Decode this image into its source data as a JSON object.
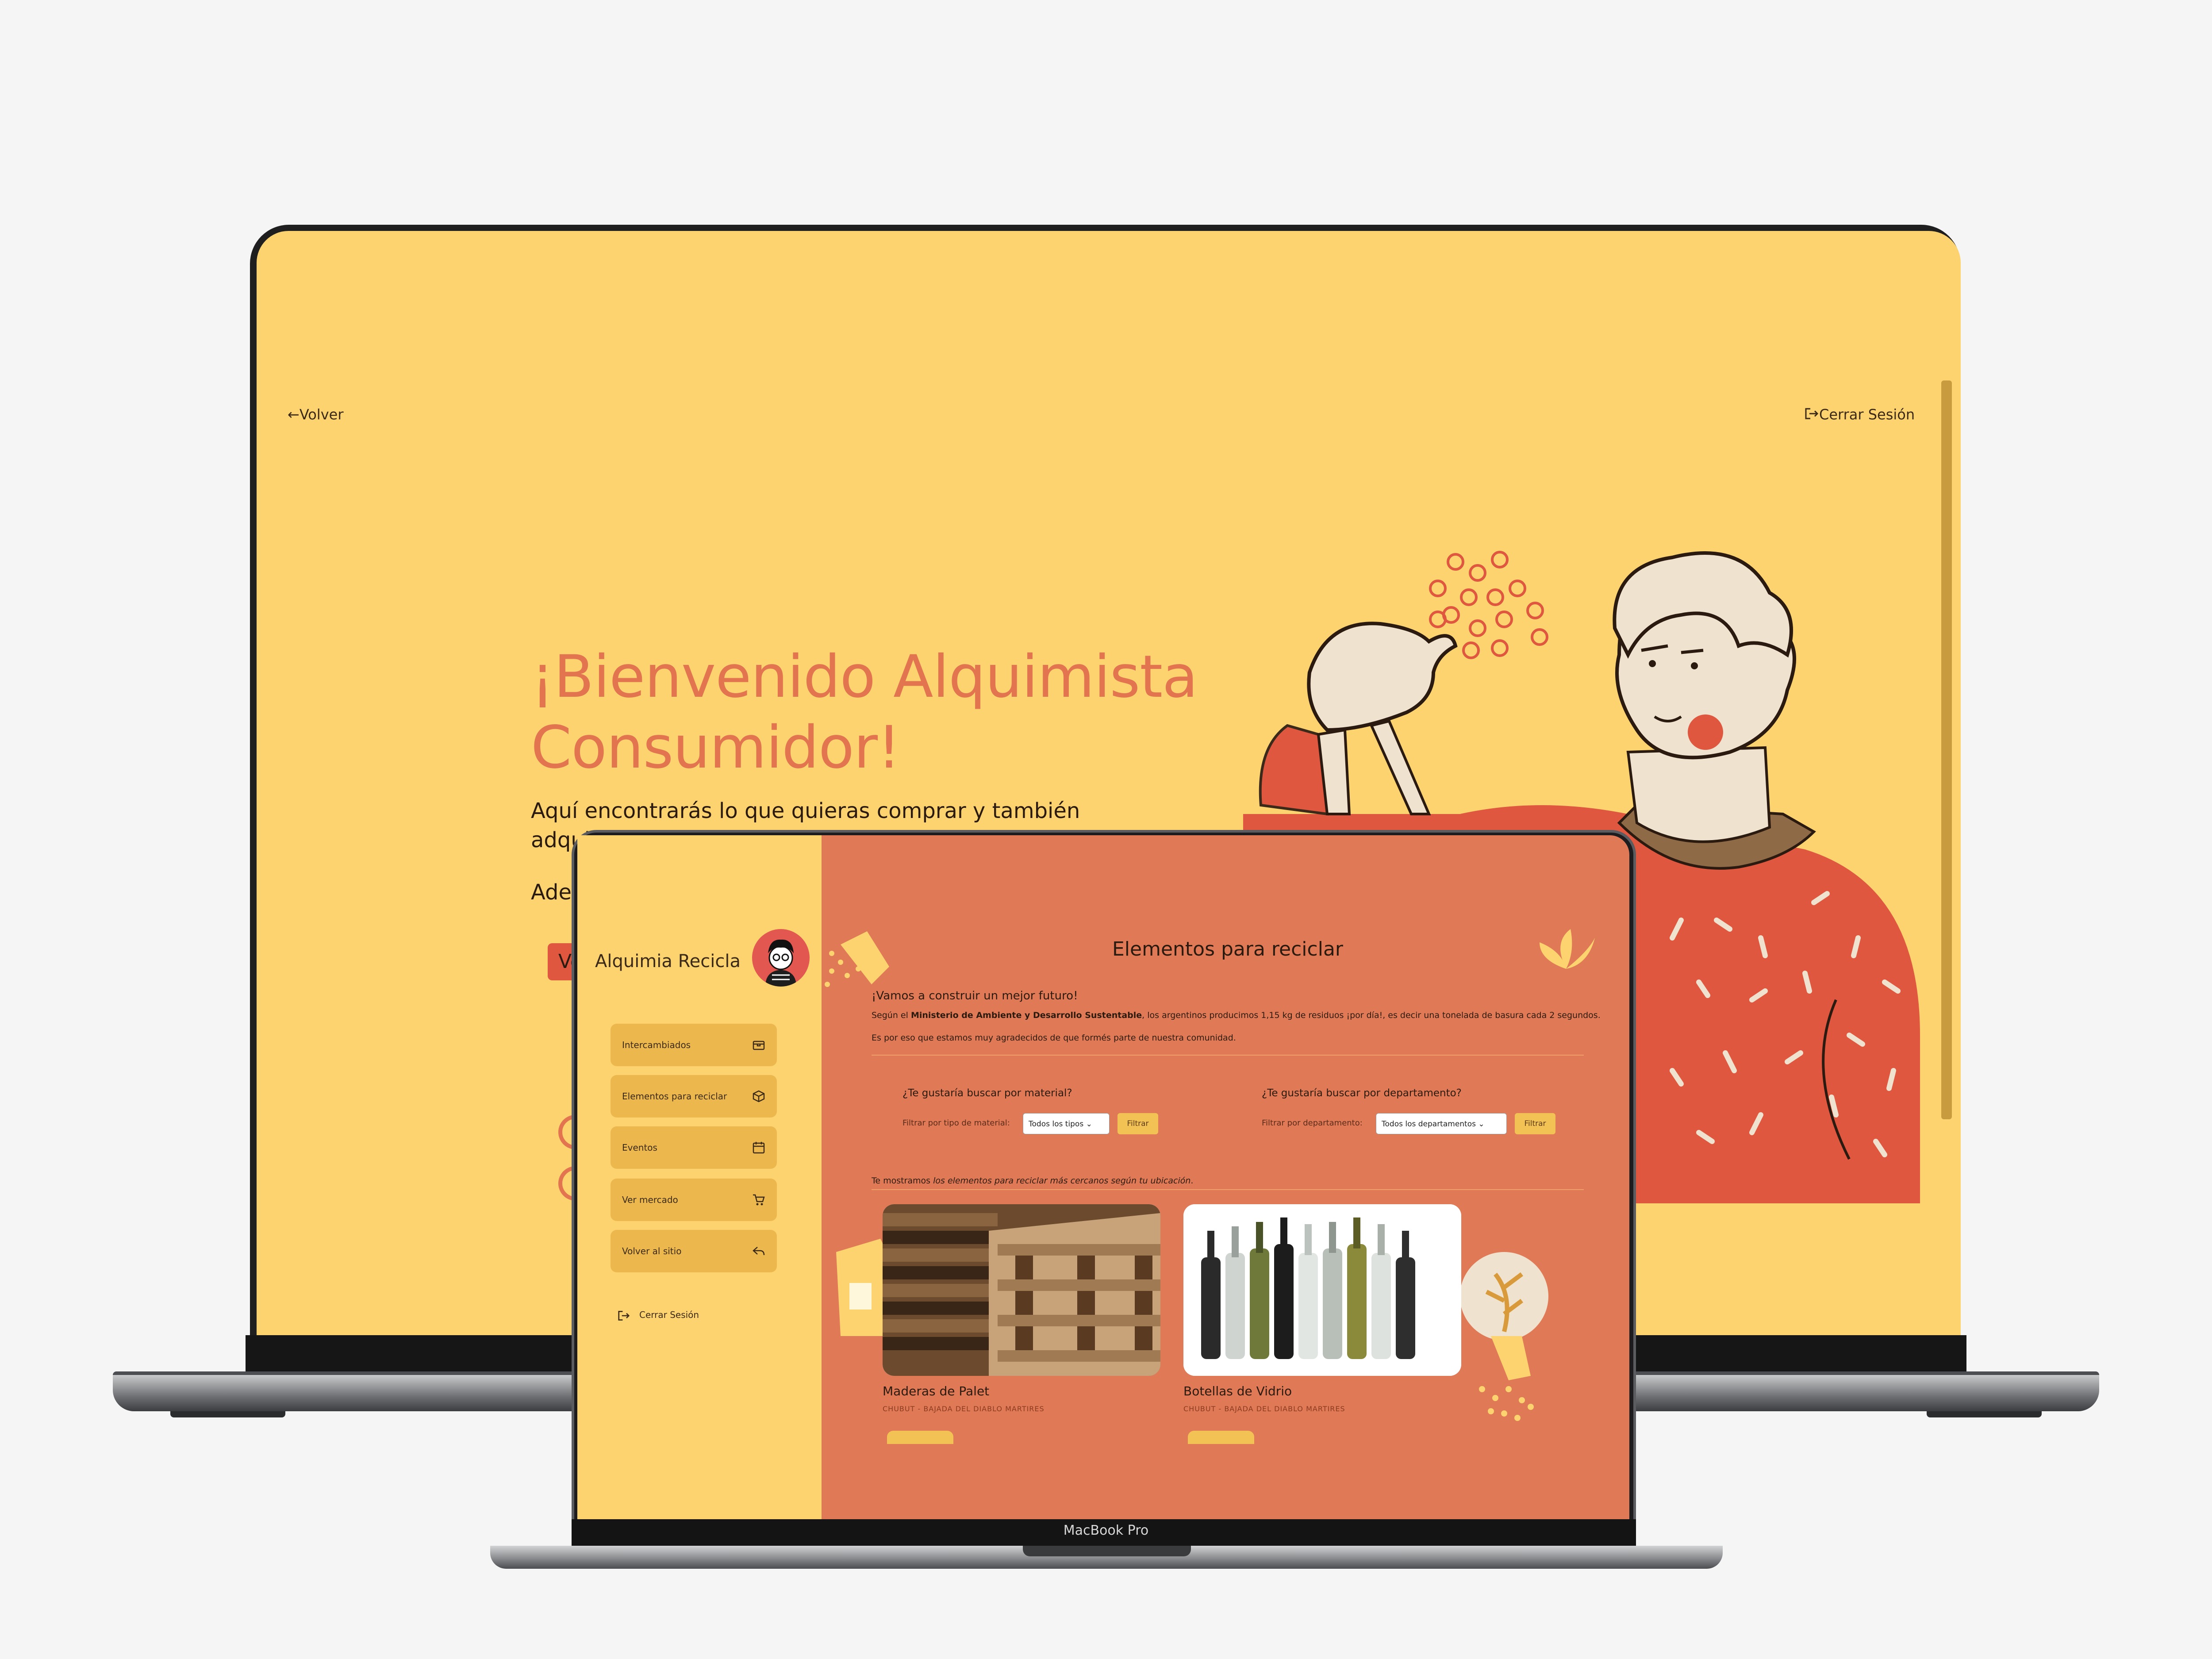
{
  "back": {
    "back_link": "Volver",
    "logout_link": "Cerrar Sesión",
    "hero_title_line1": "¡Bienvenido Alquimista",
    "hero_title_line2": "Consumidor!",
    "hero_text_line1": "Aquí encontrarás lo que quieras comprar y también",
    "hero_text_line2": "adqui",
    "hero_text_line3": "Ader",
    "hero_button": "Ve"
  },
  "front": {
    "brand": "Alquimia Recicla",
    "nav": [
      {
        "label": "Intercambiados",
        "icon": "package-icon"
      },
      {
        "label": "Elementos para reciclar",
        "icon": "box-icon"
      },
      {
        "label": "Eventos",
        "icon": "calendar-icon"
      },
      {
        "label": "Ver mercado",
        "icon": "cart-icon"
      },
      {
        "label": "Volver al sitio",
        "icon": "reply-icon"
      }
    ],
    "logout": "Cerrar Sesión",
    "page_title": "Elementos para reciclar",
    "intro_heading": "¡Vamos a construir un mejor futuro!",
    "intro_pre": "Según el ",
    "intro_bold": "Ministerio de Ambiente y Desarrollo Sustentable",
    "intro_post": ", los argentinos producimos 1,15 kg de residuos ¡por día!, es decir una tonelada de basura cada 2 segundos.",
    "intro_thanks": "Es por eso que estamos muy agradecidos de que formés parte de nuestra comunidad.",
    "filter_material": {
      "question": "¿Te gustaría buscar por material?",
      "label": "Filtrar por tipo de material:",
      "selected": "Todos los tipos",
      "button": "Filtrar"
    },
    "filter_department": {
      "question": "¿Te gustaría buscar por departamento?",
      "label": "Filtrar por departamento:",
      "selected": "Todos los departamentos",
      "button": "Filtrar"
    },
    "results_pre": "Te mostramos ",
    "results_em": "los elementos para reciclar más cercanos según tu ubicación",
    "results_post": ".",
    "cards": [
      {
        "name": "Maderas de Palet",
        "location": "CHUBUT - BAJADA DEL DIABLO MARTIRES"
      },
      {
        "name": "Botellas de Vidrio",
        "location": "CHUBUT - BAJADA DEL DIABLO MARTIRES"
      }
    ]
  },
  "device_label": "MacBook Pro",
  "colors": {
    "yellow": "#fdd36f",
    "coral": "#e07a56",
    "red": "#e0573f",
    "mustard": "#ecb84e"
  }
}
